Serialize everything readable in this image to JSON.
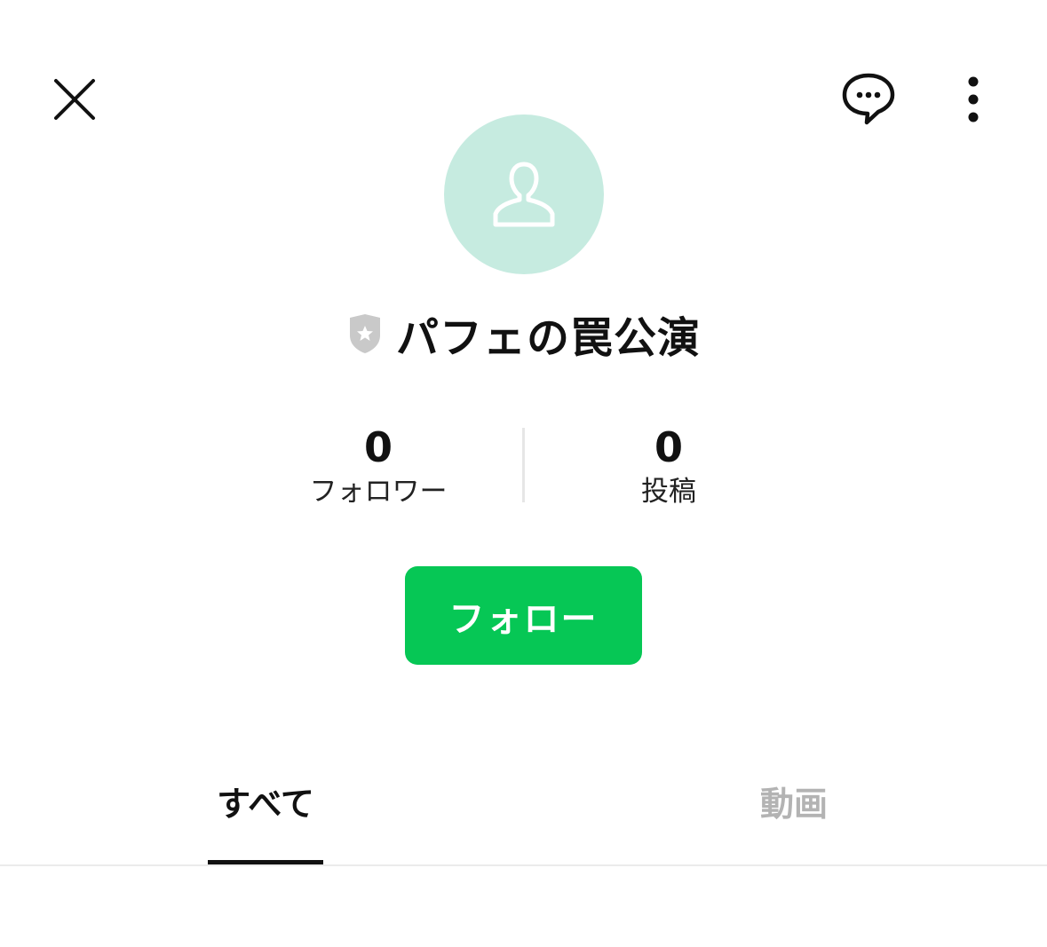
{
  "header": {
    "close_icon": "close-icon",
    "chat_icon": "chat-bubble-icon",
    "more_icon": "more-vertical-icon"
  },
  "profile": {
    "avatar_icon": "person-icon",
    "avatar_color": "#c6ebe0",
    "badge_icon": "shield-star-icon",
    "name": "パフェの罠公演"
  },
  "stats": {
    "followers": {
      "value": "0",
      "label": "フォロワー"
    },
    "posts": {
      "value": "0",
      "label": "投稿"
    }
  },
  "follow_button": {
    "label": "フォロー",
    "color": "#06c755"
  },
  "tabs": [
    {
      "label": "すべて",
      "active": true
    },
    {
      "label": "動画",
      "active": false
    }
  ]
}
